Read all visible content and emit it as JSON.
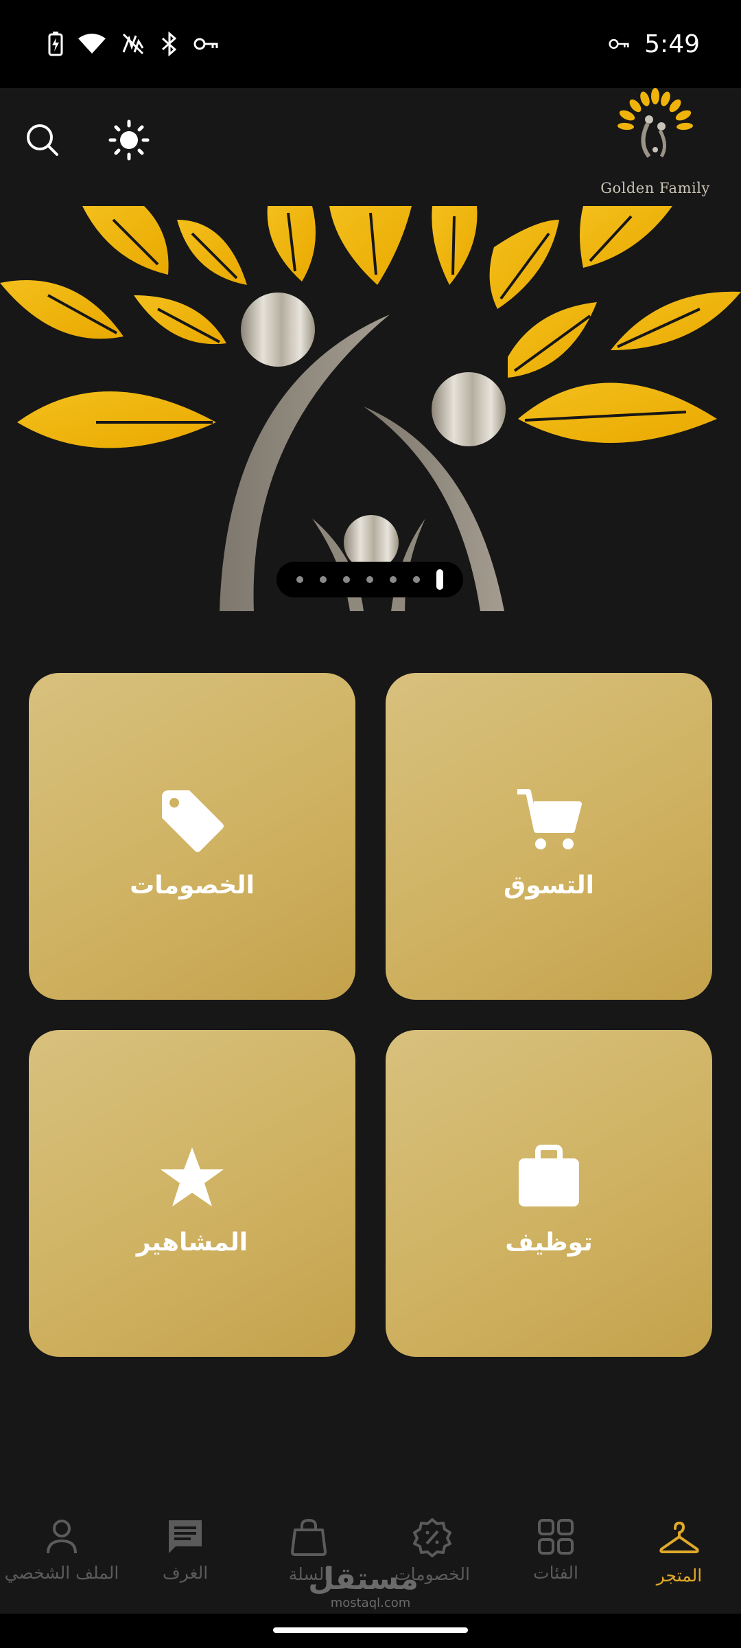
{
  "status_bar": {
    "time": "5:49",
    "icons": [
      "battery-charging-icon",
      "wifi-icon",
      "data-saver-off-icon",
      "bluetooth-icon",
      "vpn-key-icon"
    ],
    "right_icons": [
      "vpn-key-icon"
    ]
  },
  "header": {
    "logo_text": "Golden Family",
    "icons": [
      "search-icon",
      "theme-sun-icon"
    ]
  },
  "banner": {
    "page_count": 7,
    "active_page": 7
  },
  "tiles": [
    {
      "id": "shopping",
      "label": "التسوق",
      "icon": "cart-icon"
    },
    {
      "id": "discounts",
      "label": "الخصومات",
      "icon": "tag-icon"
    },
    {
      "id": "jobs",
      "label": "توظيف",
      "icon": "briefcase-icon"
    },
    {
      "id": "celebrities",
      "label": "المشاهير",
      "icon": "star-icon"
    }
  ],
  "bottom_nav": {
    "items": [
      {
        "label": "المتجر",
        "icon": "hanger-icon",
        "active": true
      },
      {
        "label": "الفئات",
        "icon": "grid-icon",
        "active": false
      },
      {
        "label": "الخصومات",
        "icon": "percent-badge-icon",
        "active": false
      },
      {
        "label": "السلة",
        "icon": "bag-icon",
        "active": false
      },
      {
        "label": "الغرف",
        "icon": "chat-icon",
        "active": false
      },
      {
        "label": "الملف الشخصي",
        "icon": "person-icon",
        "active": false
      }
    ]
  },
  "watermark": {
    "main": "مستقل",
    "sub": "mostaql.com"
  },
  "colors": {
    "background": "#171717",
    "tile_gold": "#cfb262",
    "accent": "#e0a92a",
    "leaf": "#f0b30c",
    "inactive": "#5b5b5b"
  }
}
